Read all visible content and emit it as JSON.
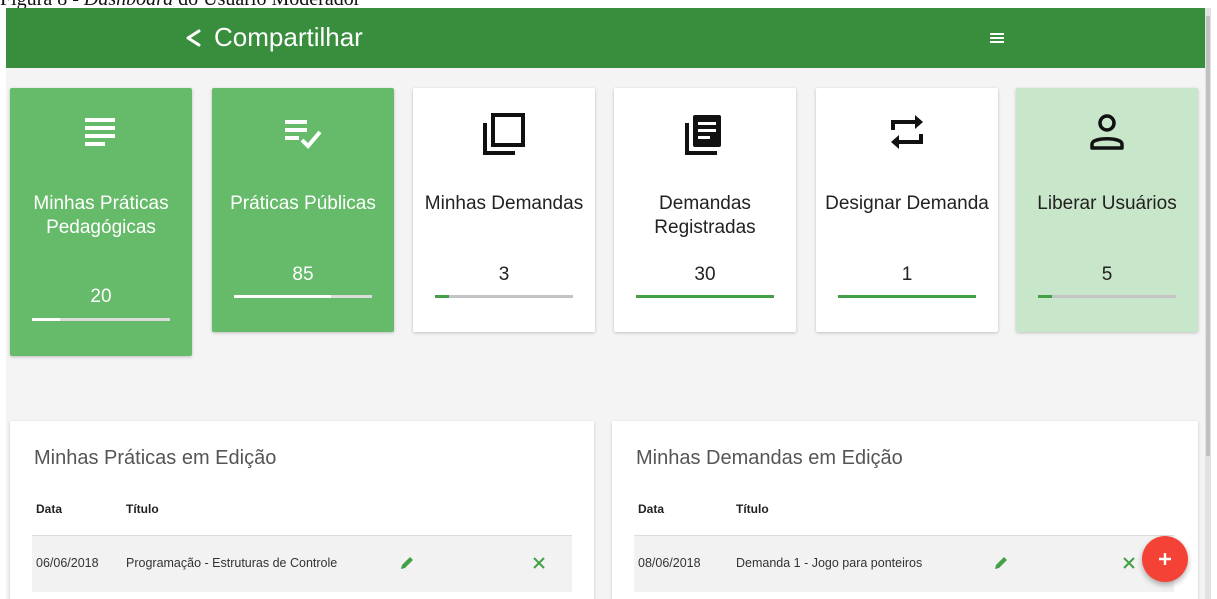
{
  "caption": {
    "prefix": "Figura 8 - ",
    "emph": "Dashboard",
    "suffix": " do Usuário Moderador"
  },
  "topbar": {
    "title": "Compartilhar",
    "bg": "#388e3c"
  },
  "cards": [
    {
      "label": "Minhas Práticas Pedagógicas",
      "count": "20",
      "progress": 0.2,
      "icon": "notes-icon"
    },
    {
      "label": "Práticas Públicas",
      "count": "85",
      "progress": 0.7,
      "icon": "list-check-icon"
    },
    {
      "label": "Minhas Demandas",
      "count": "3",
      "progress": 0.1,
      "icon": "library-icon"
    },
    {
      "label": "Demandas Registradas",
      "count": "30",
      "progress": 1.0,
      "icon": "book-stack-icon"
    },
    {
      "label": "Designar Demanda",
      "count": "1",
      "progress": 1.0,
      "icon": "swap-icon"
    },
    {
      "label": "Liberar Usuários",
      "count": "5",
      "progress": 0.1,
      "icon": "person-icon"
    }
  ],
  "panels": {
    "praticas": {
      "title": "Minhas Práticas em Edição",
      "col_date": "Data",
      "col_title": "Título",
      "rows": [
        {
          "date": "06/06/2018",
          "title": "Programação - Estruturas de Controle"
        }
      ]
    },
    "demandas": {
      "title": "Minhas Demandas em Edição",
      "col_date": "Data",
      "col_title": "Título",
      "rows": [
        {
          "date": "08/06/2018",
          "title": "Demanda 1 - Jogo para ponteiros"
        }
      ]
    }
  },
  "colors": {
    "accent": "#43a047",
    "fab": "#f44336",
    "card_green": "#66bb6a",
    "card_light": "#c8e6c9"
  }
}
